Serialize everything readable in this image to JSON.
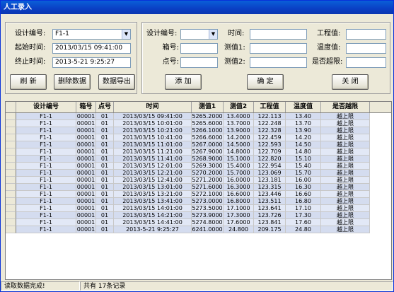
{
  "window": {
    "title": "人工录入"
  },
  "query": {
    "design_no_label": "设计编号:",
    "design_no_value": "F1-1",
    "start_label": "起始时间:",
    "start_value": "2013/03/15 09:41:00",
    "end_label": "终止时间:",
    "end_value": "2013-5-21 9:25:27",
    "refresh_label": "刷 新",
    "delete_label": "删除数据",
    "export_label": "数据导出"
  },
  "entry": {
    "design_no_label": "设计编号:",
    "design_no_value": "",
    "time_label": "时间:",
    "time_value": "",
    "eng_label": "工程值:",
    "eng_value": "",
    "box_label": "箱号:",
    "box_value": "",
    "m1_label": "测值1:",
    "m1_value": "",
    "temp_label": "温度值:",
    "temp_value": "",
    "point_label": "点号:",
    "point_value": "",
    "m2_label": "测值2:",
    "m2_value": "",
    "over_label": "是否超限:",
    "over_value": "",
    "add_label": "添 加",
    "confirm_label": "确 定",
    "close_label": "关 闭"
  },
  "grid": {
    "columns": [
      "设计编号",
      "箱号",
      "点号",
      "时间",
      "测值1",
      "测值2",
      "工程值",
      "温度值",
      "是否越限"
    ],
    "rows": [
      [
        "F1-1",
        "00001",
        "01",
        "2013/03/15 09:41:00",
        "5265.2000",
        "13.4000",
        "122.113",
        "13.40",
        "越上限"
      ],
      [
        "F1-1",
        "00001",
        "01",
        "2013/03/15 10:01:00",
        "5265.6000",
        "13.7000",
        "122.248",
        "13.70",
        "越上限"
      ],
      [
        "F1-1",
        "00001",
        "01",
        "2013/03/15 10:21:00",
        "5266.1000",
        "13.9000",
        "122.328",
        "13.90",
        "越上限"
      ],
      [
        "F1-1",
        "00001",
        "01",
        "2013/03/15 10:41:00",
        "5266.6000",
        "14.2000",
        "122.459",
        "14.20",
        "越上限"
      ],
      [
        "F1-1",
        "00001",
        "01",
        "2013/03/15 11:01:00",
        "5267.0000",
        "14.5000",
        "122.593",
        "14.50",
        "越上限"
      ],
      [
        "F1-1",
        "00001",
        "01",
        "2013/03/15 11:21:00",
        "5267.9000",
        "14.8000",
        "122.709",
        "14.80",
        "越上限"
      ],
      [
        "F1-1",
        "00001",
        "01",
        "2013/03/15 11:41:00",
        "5268.9000",
        "15.1000",
        "122.820",
        "15.10",
        "越上限"
      ],
      [
        "F1-1",
        "00001",
        "01",
        "2013/03/15 12:01:00",
        "5269.3000",
        "15.4000",
        "122.954",
        "15.40",
        "越上限"
      ],
      [
        "F1-1",
        "00001",
        "01",
        "2013/03/15 12:21:00",
        "5270.2000",
        "15.7000",
        "123.069",
        "15.70",
        "越上限"
      ],
      [
        "F1-1",
        "00001",
        "01",
        "2013/03/15 12:41:00",
        "5271.2000",
        "16.0000",
        "123.181",
        "16.00",
        "越上限"
      ],
      [
        "F1-1",
        "00001",
        "01",
        "2013/03/15 13:01:00",
        "5271.6000",
        "16.3000",
        "123.315",
        "16.30",
        "越上限"
      ],
      [
        "F1-1",
        "00001",
        "01",
        "2013/03/15 13:21:00",
        "5272.1000",
        "16.6000",
        "123.446",
        "16.60",
        "越上限"
      ],
      [
        "F1-1",
        "00001",
        "01",
        "2013/03/15 13:41:00",
        "5273.0000",
        "16.8000",
        "123.511",
        "16.80",
        "越上限"
      ],
      [
        "F1-1",
        "00001",
        "01",
        "2013/03/15 14:01:00",
        "5273.5000",
        "17.1000",
        "123.641",
        "17.10",
        "越上限"
      ],
      [
        "F1-1",
        "00001",
        "01",
        "2013/03/15 14:21:00",
        "5273.9000",
        "17.3000",
        "123.726",
        "17.30",
        "越上限"
      ],
      [
        "F1-1",
        "00001",
        "01",
        "2013/03/15 14:41:00",
        "5274.8000",
        "17.6000",
        "123.841",
        "17.60",
        "越上限"
      ],
      [
        "F1-1",
        "00001",
        "01",
        "2013-5-21 9:25:27",
        "6241.0000",
        "24.800",
        "209.175",
        "24.80",
        "越上限"
      ]
    ]
  },
  "status": {
    "message": "读取数据完成!",
    "count": "共有 17条记录"
  }
}
